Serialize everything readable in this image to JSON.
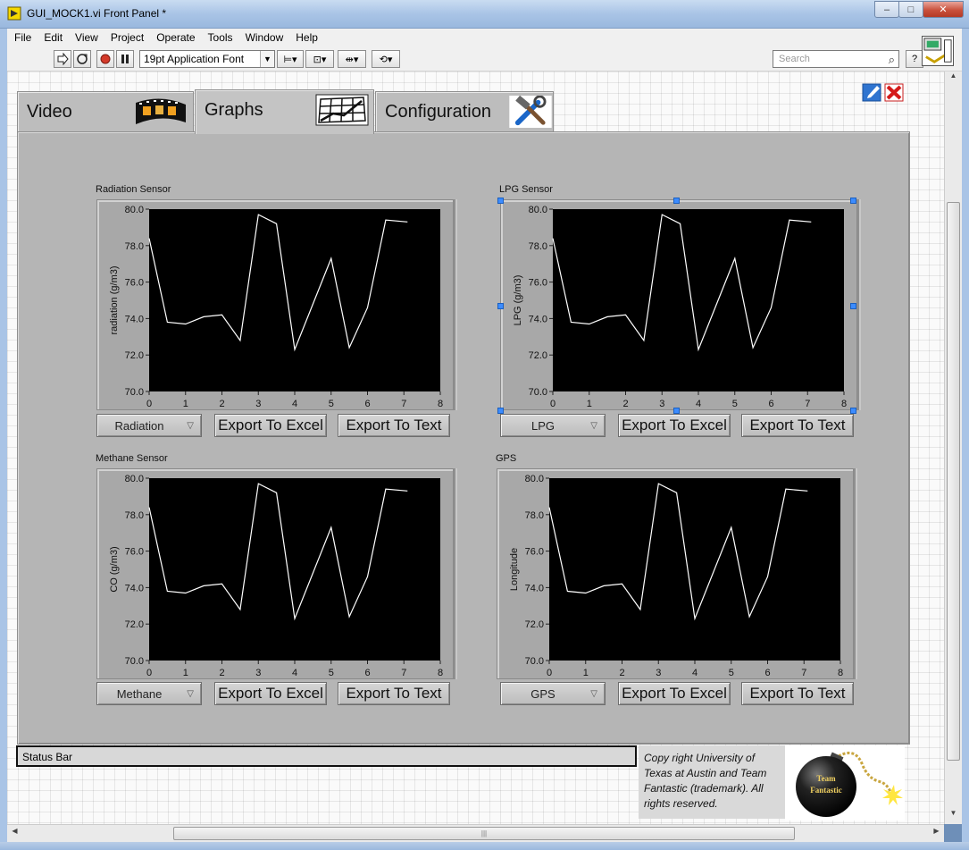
{
  "window": {
    "title": "GUI_MOCK1.vi Front Panel *",
    "controls": {
      "minimize": "–",
      "maximize": "□",
      "close": "✕"
    }
  },
  "menu": [
    "File",
    "Edit",
    "View",
    "Project",
    "Operate",
    "Tools",
    "Window",
    "Help"
  ],
  "toolbar": {
    "font_select": "19pt Application Font",
    "search_placeholder": "Search",
    "help": "?"
  },
  "tabs": [
    {
      "label": "Video",
      "icon": "film-strip-icon",
      "active": false
    },
    {
      "label": "Graphs",
      "icon": "graph-icon",
      "active": true
    },
    {
      "label": "Configuration",
      "icon": "tools-icon",
      "active": false
    }
  ],
  "graphs": [
    {
      "title": "Radiation Sensor",
      "ylabel": "radiation (g/m3)",
      "dropdown": "Radiation",
      "export_excel": "Export To Excel",
      "export_text": "Export To Text",
      "selected": false
    },
    {
      "title": "LPG Sensor",
      "ylabel": "LPG (g/m3)",
      "dropdown": "LPG",
      "export_excel": "Export To Excel",
      "export_text": "Export To Text",
      "selected": true
    },
    {
      "title": "Methane Sensor",
      "ylabel": "CO (g/m3)",
      "dropdown": "Methane",
      "export_excel": "Export To Excel",
      "export_text": "Export To Text",
      "selected": false
    },
    {
      "title": "GPS",
      "ylabel": "Longitude",
      "dropdown": "GPS",
      "export_excel": "Export To Excel",
      "export_text": "Export To Text",
      "selected": false
    }
  ],
  "chart_data": {
    "type": "line",
    "x": [
      0,
      0.5,
      1,
      1.5,
      2,
      2.5,
      3,
      3.5,
      4,
      4.5,
      5,
      5.5,
      6,
      6.5,
      7.1
    ],
    "y": [
      78.4,
      73.8,
      73.7,
      74.1,
      74.2,
      72.8,
      79.7,
      79.2,
      72.3,
      74.8,
      77.3,
      72.4,
      74.6,
      79.4,
      79.3
    ],
    "xlim": [
      0,
      8
    ],
    "ylim": [
      70,
      80
    ],
    "xticks": [
      "0",
      "1",
      "2",
      "3",
      "4",
      "5",
      "6",
      "7",
      "8"
    ],
    "yticks": [
      "70.0",
      "72.0",
      "74.0",
      "76.0",
      "78.0",
      "80.0"
    ],
    "grid": false,
    "colors": {
      "plot_bg": "#000000",
      "line": "#ffffff"
    }
  },
  "status_bar": "Status Bar",
  "copyright": "Copy right University of Texas at Austin and Team Fantastic (trademark). All rights reserved.",
  "team_logo": {
    "line1": "Team",
    "line2": "Fantastic"
  }
}
